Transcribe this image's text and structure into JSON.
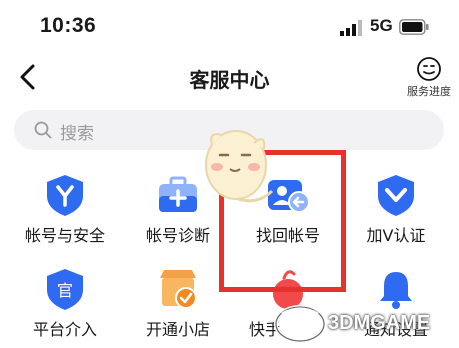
{
  "status_bar": {
    "time": "10:36",
    "network": "5G"
  },
  "nav": {
    "title": "客服中心",
    "progress_label": "服务进度"
  },
  "search": {
    "placeholder": "搜索"
  },
  "items": [
    {
      "label": "帐号与安全",
      "icon": "shield-y-icon"
    },
    {
      "label": "帐号诊断",
      "icon": "medical-kit-icon"
    },
    {
      "label": "找回帐号",
      "icon": "account-retrieve-icon"
    },
    {
      "label": "加V认证",
      "icon": "v-badge-icon"
    },
    {
      "label": "平台介入",
      "icon": "official-badge-icon"
    },
    {
      "label": "开通小店",
      "icon": "store-check-icon"
    },
    {
      "label": "快手",
      "icon": "kuaishou-icon"
    },
    {
      "label": "通知设置",
      "icon": "bell-icon"
    }
  ],
  "watermark": {
    "text": "3DMGAME"
  },
  "colors": {
    "accent": "#2f6bf0",
    "highlight": "#e5322d",
    "icon_light": "#8fb3fb"
  }
}
